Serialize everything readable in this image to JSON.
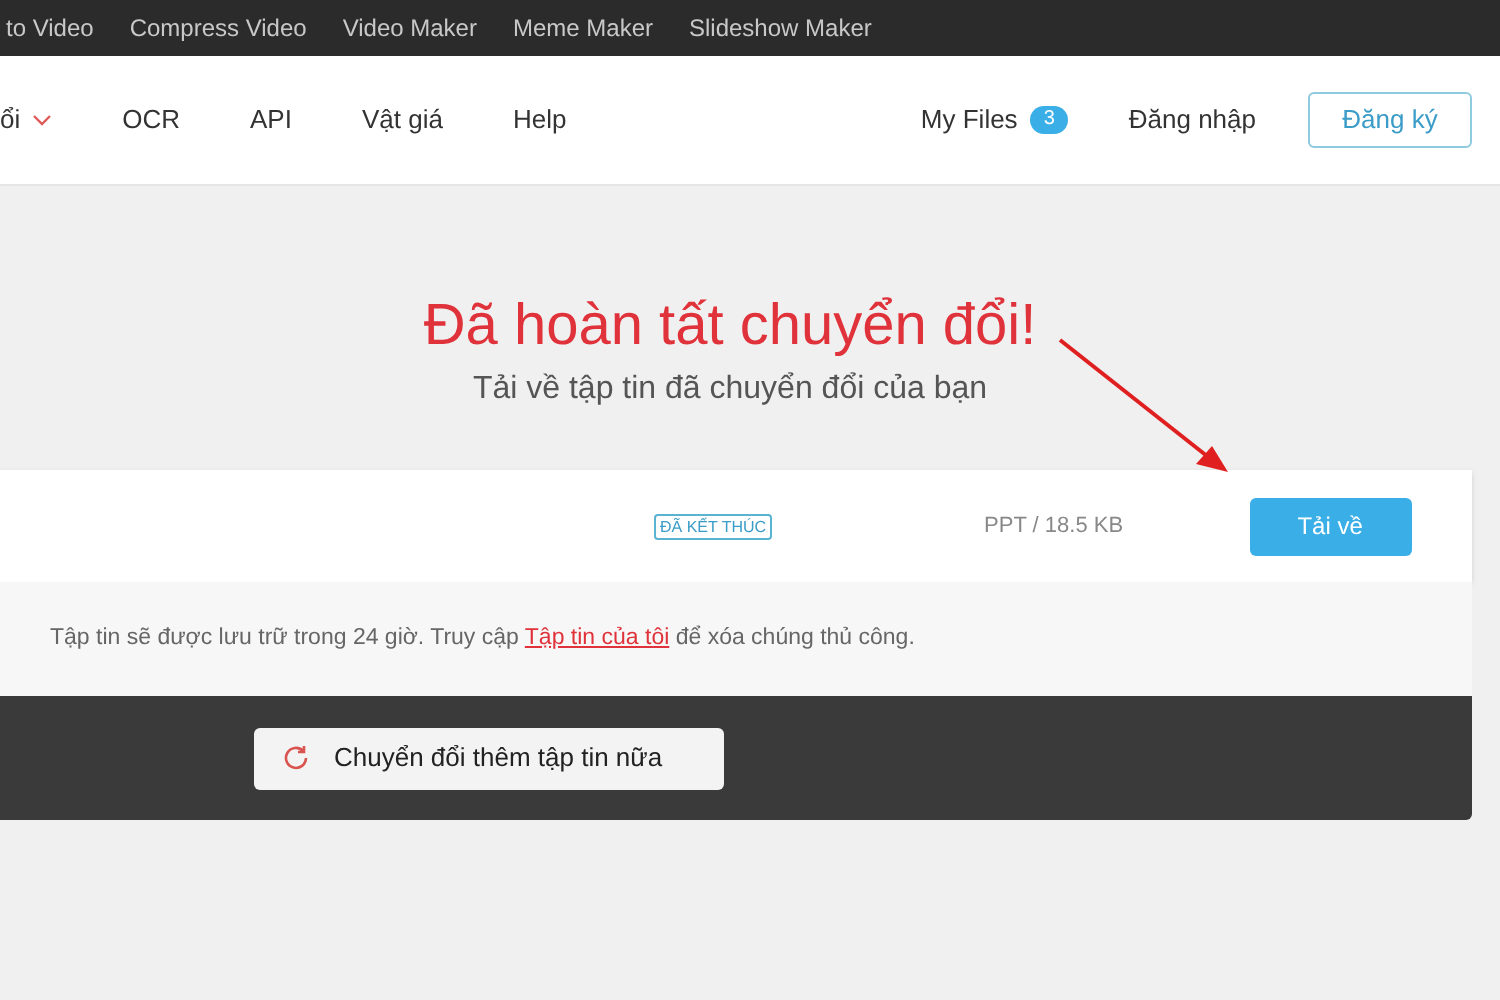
{
  "top_links": [
    "to Video",
    "Compress Video",
    "Video Maker",
    "Meme Maker",
    "Slideshow Maker"
  ],
  "nav": {
    "menu_items": [
      {
        "label": "ổi",
        "kind": "dropdown"
      },
      {
        "label": "OCR",
        "kind": "link"
      },
      {
        "label": "API",
        "kind": "link"
      },
      {
        "label": "Vật giá",
        "kind": "link"
      },
      {
        "label": "Help",
        "kind": "link"
      }
    ],
    "my_files": {
      "label": "My Files",
      "count": "3"
    },
    "login": "Đăng nhập",
    "signup": "Đăng ký"
  },
  "heading": "Đã hoàn tất chuyển đổi!",
  "subheading": "Tải về tập tin đã chuyển đổi của bạn",
  "file_row": {
    "status": "ĐÃ KẾT THÚC",
    "info": "PPT / 18.5 KB",
    "download": "Tải về"
  },
  "note": {
    "before": "Tập tin sẽ được lưu trữ trong 24 giờ. Truy cập ",
    "link": "Tập tin của tôi",
    "after": " để xóa chúng thủ công."
  },
  "convert_more": "Chuyển đổi thêm tập tin nữa"
}
